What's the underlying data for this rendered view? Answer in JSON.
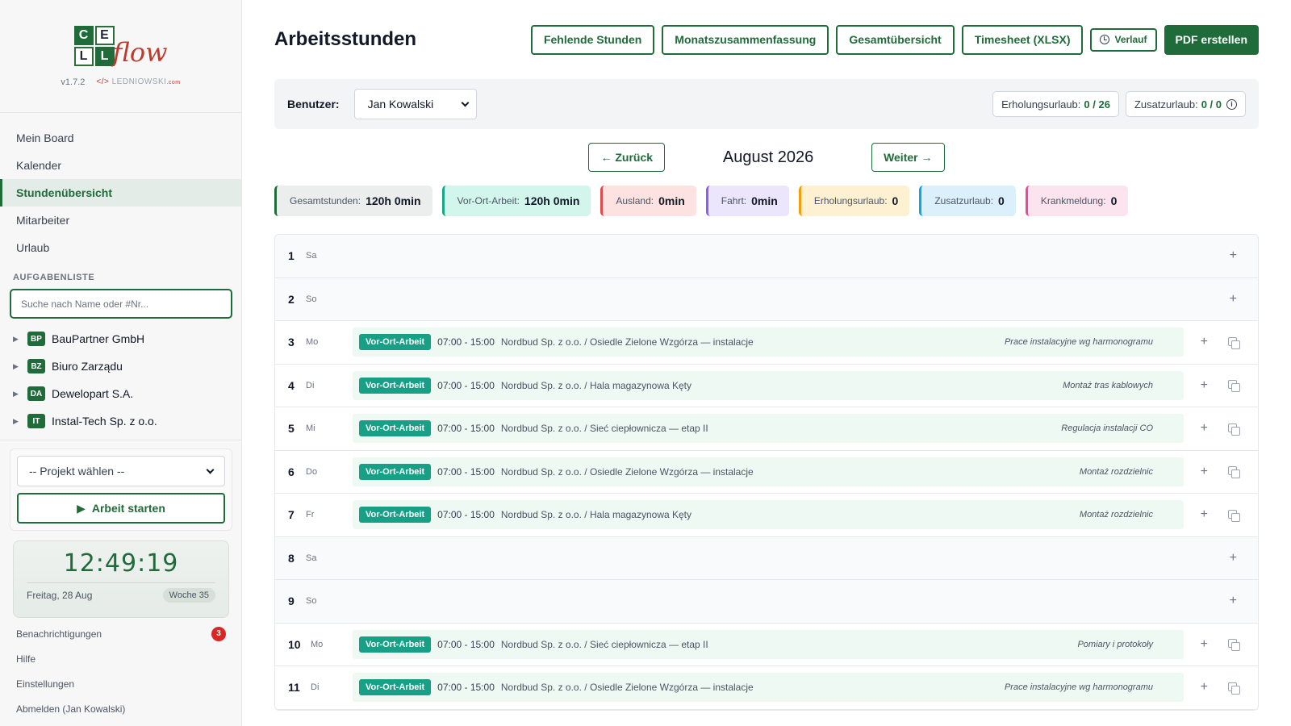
{
  "sidebar": {
    "logo": {
      "letters": [
        "C",
        "E",
        "L",
        "L"
      ],
      "word": "flow",
      "version": "v1.7.2",
      "dev_prefix": "</>",
      "dev_name": "LEDNIOWSKI",
      "dev_suffix": ".com"
    },
    "nav": [
      {
        "label": "Mein Board",
        "active": false
      },
      {
        "label": "Kalender",
        "active": false
      },
      {
        "label": "Stundenübersicht",
        "active": true
      },
      {
        "label": "Mitarbeiter",
        "active": false
      },
      {
        "label": "Urlaub",
        "active": false
      }
    ],
    "tasks_title": "AUFGABENLISTE",
    "search_placeholder": "Suche nach Name oder #Nr...",
    "tree": [
      {
        "badge": "BP",
        "label": "BauPartner GmbH"
      },
      {
        "badge": "BZ",
        "label": "Biuro Zarządu"
      },
      {
        "badge": "DA",
        "label": "Dewelopart S.A."
      },
      {
        "badge": "IT",
        "label": "Instal-Tech Sp. z o.o."
      }
    ],
    "project_select": "-- Projekt wählen --",
    "start_label": "Arbeit starten",
    "clock": {
      "time": "12:49:19",
      "date": "Freitag, 28 Aug",
      "week": "Woche 35"
    },
    "footer": {
      "notifications": "Benachrichtigungen",
      "notifications_count": "3",
      "help": "Hilfe",
      "settings": "Einstellungen",
      "logout": "Abmelden (Jan Kowalski)"
    }
  },
  "header": {
    "title": "Arbeitsstunden",
    "actions": {
      "missing": "Fehlende Stunden",
      "monthly": "Monatszusammenfassung",
      "overview": "Gesamtübersicht",
      "timesheet": "Timesheet (XLSX)",
      "history": "Verlauf",
      "pdf": "PDF erstellen"
    }
  },
  "user_bar": {
    "label": "Benutzer:",
    "selected_user": "Jan Kowalski",
    "vacation_label": "Erholungsurlaub:",
    "vacation_value": "0 / 26",
    "extra_label": "Zusatzurlaub:",
    "extra_value": "0 / 0"
  },
  "month_nav": {
    "prev": "← Zurück",
    "month": "August 2026",
    "next": "Weiter →"
  },
  "stats": [
    {
      "label": "Gesamtstunden:",
      "value": "120h 0min",
      "bg": "#eceeed",
      "accent": "#1f6b3a"
    },
    {
      "label": "Vor-Ort-Arbeit:",
      "value": "120h 0min",
      "bg": "#d3f6ec",
      "accent": "#1aa58a"
    },
    {
      "label": "Ausland:",
      "value": "0min",
      "bg": "#fde2e2",
      "accent": "#e24b4b"
    },
    {
      "label": "Fahrt:",
      "value": "0min",
      "bg": "#ebe6fb",
      "accent": "#8b5cf6"
    },
    {
      "label": "Erholungsurlaub:",
      "value": "0",
      "bg": "#fdf1d2",
      "accent": "#f59e0b"
    },
    {
      "label": "Zusatzurlaub:",
      "value": "0",
      "bg": "#dcf0fc",
      "accent": "#0ea5e9"
    },
    {
      "label": "Krankmeldung:",
      "value": "0",
      "bg": "#fce4ee",
      "accent": "#ec4899"
    }
  ],
  "days": [
    {
      "num": "1",
      "wd": "Sa",
      "entry": null
    },
    {
      "num": "2",
      "wd": "So",
      "entry": null
    },
    {
      "num": "3",
      "wd": "Mo",
      "entry": {
        "type": "Vor-Ort-Arbeit",
        "time": "07:00 - 15:00",
        "project": "Nordbud Sp. z o.o. / Osiedle Zielone Wzgórza — instalacje",
        "note": "Prace instalacyjne wg harmonogramu"
      }
    },
    {
      "num": "4",
      "wd": "Di",
      "entry": {
        "type": "Vor-Ort-Arbeit",
        "time": "07:00 - 15:00",
        "project": "Nordbud Sp. z o.o. / Hala magazynowa Kęty",
        "note": "Montaż tras kablowych"
      }
    },
    {
      "num": "5",
      "wd": "Mi",
      "entry": {
        "type": "Vor-Ort-Arbeit",
        "time": "07:00 - 15:00",
        "project": "Nordbud Sp. z o.o. / Sieć ciepłownicza — etap II",
        "note": "Regulacja instalacji CO"
      }
    },
    {
      "num": "6",
      "wd": "Do",
      "entry": {
        "type": "Vor-Ort-Arbeit",
        "time": "07:00 - 15:00",
        "project": "Nordbud Sp. z o.o. / Osiedle Zielone Wzgórza — instalacje",
        "note": "Montaż rozdzielnic"
      }
    },
    {
      "num": "7",
      "wd": "Fr",
      "entry": {
        "type": "Vor-Ort-Arbeit",
        "time": "07:00 - 15:00",
        "project": "Nordbud Sp. z o.o. / Hala magazynowa Kęty",
        "note": "Montaż rozdzielnic"
      }
    },
    {
      "num": "8",
      "wd": "Sa",
      "entry": null
    },
    {
      "num": "9",
      "wd": "So",
      "entry": null
    },
    {
      "num": "10",
      "wd": "Mo",
      "entry": {
        "type": "Vor-Ort-Arbeit",
        "time": "07:00 - 15:00",
        "project": "Nordbud Sp. z o.o. / Sieć ciepłownicza — etap II",
        "note": "Pomiary i protokoły"
      }
    },
    {
      "num": "11",
      "wd": "Di",
      "entry": {
        "type": "Vor-Ort-Arbeit",
        "time": "07:00 - 15:00",
        "project": "Nordbud Sp. z o.o. / Osiedle Zielone Wzgórza — instalacje",
        "note": "Prace instalacyjne wg harmonogramu"
      }
    }
  ]
}
